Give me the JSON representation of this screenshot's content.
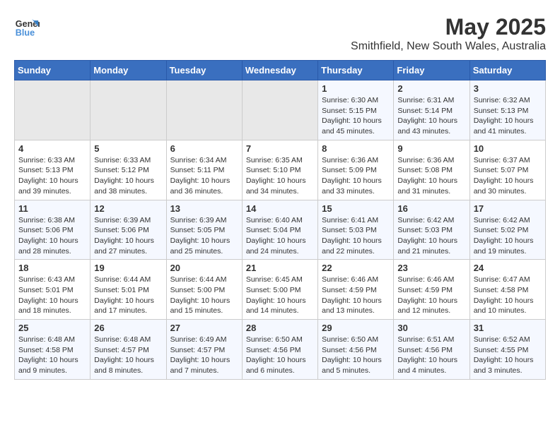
{
  "logo": {
    "line1": "General",
    "line2": "Blue"
  },
  "title": "May 2025",
  "subtitle": "Smithfield, New South Wales, Australia",
  "days_of_week": [
    "Sunday",
    "Monday",
    "Tuesday",
    "Wednesday",
    "Thursday",
    "Friday",
    "Saturday"
  ],
  "weeks": [
    [
      {
        "day": "",
        "info": ""
      },
      {
        "day": "",
        "info": ""
      },
      {
        "day": "",
        "info": ""
      },
      {
        "day": "",
        "info": ""
      },
      {
        "day": "1",
        "info": "Sunrise: 6:30 AM\nSunset: 5:15 PM\nDaylight: 10 hours\nand 45 minutes."
      },
      {
        "day": "2",
        "info": "Sunrise: 6:31 AM\nSunset: 5:14 PM\nDaylight: 10 hours\nand 43 minutes."
      },
      {
        "day": "3",
        "info": "Sunrise: 6:32 AM\nSunset: 5:13 PM\nDaylight: 10 hours\nand 41 minutes."
      }
    ],
    [
      {
        "day": "4",
        "info": "Sunrise: 6:33 AM\nSunset: 5:13 PM\nDaylight: 10 hours\nand 39 minutes."
      },
      {
        "day": "5",
        "info": "Sunrise: 6:33 AM\nSunset: 5:12 PM\nDaylight: 10 hours\nand 38 minutes."
      },
      {
        "day": "6",
        "info": "Sunrise: 6:34 AM\nSunset: 5:11 PM\nDaylight: 10 hours\nand 36 minutes."
      },
      {
        "day": "7",
        "info": "Sunrise: 6:35 AM\nSunset: 5:10 PM\nDaylight: 10 hours\nand 34 minutes."
      },
      {
        "day": "8",
        "info": "Sunrise: 6:36 AM\nSunset: 5:09 PM\nDaylight: 10 hours\nand 33 minutes."
      },
      {
        "day": "9",
        "info": "Sunrise: 6:36 AM\nSunset: 5:08 PM\nDaylight: 10 hours\nand 31 minutes."
      },
      {
        "day": "10",
        "info": "Sunrise: 6:37 AM\nSunset: 5:07 PM\nDaylight: 10 hours\nand 30 minutes."
      }
    ],
    [
      {
        "day": "11",
        "info": "Sunrise: 6:38 AM\nSunset: 5:06 PM\nDaylight: 10 hours\nand 28 minutes."
      },
      {
        "day": "12",
        "info": "Sunrise: 6:39 AM\nSunset: 5:06 PM\nDaylight: 10 hours\nand 27 minutes."
      },
      {
        "day": "13",
        "info": "Sunrise: 6:39 AM\nSunset: 5:05 PM\nDaylight: 10 hours\nand 25 minutes."
      },
      {
        "day": "14",
        "info": "Sunrise: 6:40 AM\nSunset: 5:04 PM\nDaylight: 10 hours\nand 24 minutes."
      },
      {
        "day": "15",
        "info": "Sunrise: 6:41 AM\nSunset: 5:03 PM\nDaylight: 10 hours\nand 22 minutes."
      },
      {
        "day": "16",
        "info": "Sunrise: 6:42 AM\nSunset: 5:03 PM\nDaylight: 10 hours\nand 21 minutes."
      },
      {
        "day": "17",
        "info": "Sunrise: 6:42 AM\nSunset: 5:02 PM\nDaylight: 10 hours\nand 19 minutes."
      }
    ],
    [
      {
        "day": "18",
        "info": "Sunrise: 6:43 AM\nSunset: 5:01 PM\nDaylight: 10 hours\nand 18 minutes."
      },
      {
        "day": "19",
        "info": "Sunrise: 6:44 AM\nSunset: 5:01 PM\nDaylight: 10 hours\nand 17 minutes."
      },
      {
        "day": "20",
        "info": "Sunrise: 6:44 AM\nSunset: 5:00 PM\nDaylight: 10 hours\nand 15 minutes."
      },
      {
        "day": "21",
        "info": "Sunrise: 6:45 AM\nSunset: 5:00 PM\nDaylight: 10 hours\nand 14 minutes."
      },
      {
        "day": "22",
        "info": "Sunrise: 6:46 AM\nSunset: 4:59 PM\nDaylight: 10 hours\nand 13 minutes."
      },
      {
        "day": "23",
        "info": "Sunrise: 6:46 AM\nSunset: 4:59 PM\nDaylight: 10 hours\nand 12 minutes."
      },
      {
        "day": "24",
        "info": "Sunrise: 6:47 AM\nSunset: 4:58 PM\nDaylight: 10 hours\nand 10 minutes."
      }
    ],
    [
      {
        "day": "25",
        "info": "Sunrise: 6:48 AM\nSunset: 4:58 PM\nDaylight: 10 hours\nand 9 minutes."
      },
      {
        "day": "26",
        "info": "Sunrise: 6:48 AM\nSunset: 4:57 PM\nDaylight: 10 hours\nand 8 minutes."
      },
      {
        "day": "27",
        "info": "Sunrise: 6:49 AM\nSunset: 4:57 PM\nDaylight: 10 hours\nand 7 minutes."
      },
      {
        "day": "28",
        "info": "Sunrise: 6:50 AM\nSunset: 4:56 PM\nDaylight: 10 hours\nand 6 minutes."
      },
      {
        "day": "29",
        "info": "Sunrise: 6:50 AM\nSunset: 4:56 PM\nDaylight: 10 hours\nand 5 minutes."
      },
      {
        "day": "30",
        "info": "Sunrise: 6:51 AM\nSunset: 4:56 PM\nDaylight: 10 hours\nand 4 minutes."
      },
      {
        "day": "31",
        "info": "Sunrise: 6:52 AM\nSunset: 4:55 PM\nDaylight: 10 hours\nand 3 minutes."
      }
    ]
  ]
}
